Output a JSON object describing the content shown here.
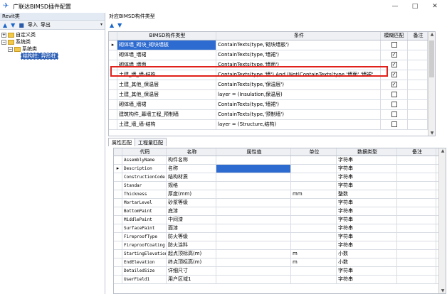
{
  "window": {
    "title": "广联达BIMSD插件配置",
    "controls": [
      "—",
      "□",
      "✕"
    ]
  },
  "left_panel": {
    "header": "Revit类",
    "toolbar": {
      "import_label": "导入",
      "export_label": "导出"
    },
    "tree": {
      "root1": "自定义类",
      "root2": "系统类",
      "child1": "系统类",
      "selected": "结构柱: 异形柱"
    }
  },
  "type_panel": {
    "header": "对应BIMSD构件类型",
    "columns": [
      "BIMSD构件类型",
      "条件",
      "模糊匹配",
      "备注"
    ],
    "rows": [
      {
        "type": "砌体墙_砌块_砌块墙板",
        "condition": "ContainTexts(type,'砌块墙板')",
        "fuzzy": false,
        "note": ""
      },
      {
        "type": "砌体墙_墙裙",
        "condition": "ContainTexts(type,'墙裙')",
        "fuzzy": true,
        "note": ""
      },
      {
        "type": "砌体墙_墙面",
        "condition": "ContainTexts(type,'墙面')",
        "fuzzy": true,
        "note": ""
      },
      {
        "type": "土建_墙_墙-结构",
        "condition": "ContainTexts(type,'墙') And (Not(ContainTexts(type,'墙面','墙裙'",
        "fuzzy": true,
        "note": ""
      },
      {
        "type": "土建_其他_保温层",
        "condition": "ContainTexts(type,'保温层')",
        "fuzzy": true,
        "note": ""
      },
      {
        "type": "土建_其他_保温层",
        "condition": "layer = (Insulation,保温层)",
        "fuzzy": false,
        "note": ""
      },
      {
        "type": "砌体墙_墙裙",
        "condition": "ContainTexts(type,'墙裙')",
        "fuzzy": false,
        "note": ""
      },
      {
        "type": "建筑构件_幕墙工程_预制墙",
        "condition": "ContainTexts(type,'预制墙')",
        "fuzzy": false,
        "note": ""
      },
      {
        "type": "土建_墙_墙-结构",
        "condition": "layer = (Structure,结构)",
        "fuzzy": false,
        "note": ""
      }
    ]
  },
  "tabs": [
    "属性匹配",
    "工程量匹配"
  ],
  "property_grid": {
    "columns": [
      "代码",
      "名称",
      "属性值",
      "单位",
      "数据类型",
      "备注"
    ],
    "rows": [
      {
        "code": "AssemblyName",
        "name": "构件名称",
        "value": "",
        "unit": "",
        "dtype": "字符串",
        "note": ""
      },
      {
        "code": "Description",
        "name": "名称",
        "value": "",
        "unit": "",
        "dtype": "字符串",
        "note": ""
      },
      {
        "code": "ConstructionCode",
        "name": "结构材质",
        "value": "",
        "unit": "",
        "dtype": "字符串",
        "note": ""
      },
      {
        "code": "Standar",
        "name": "规格",
        "value": "",
        "unit": "",
        "dtype": "字符串",
        "note": ""
      },
      {
        "code": "Thickness",
        "name": "厚度(mm)",
        "value": "",
        "unit": "mm",
        "dtype": "整数",
        "note": ""
      },
      {
        "code": "MortarLevel",
        "name": "砂浆等级",
        "value": "",
        "unit": "",
        "dtype": "字符串",
        "note": ""
      },
      {
        "code": "BottomPaint",
        "name": "底漆",
        "value": "",
        "unit": "",
        "dtype": "字符串",
        "note": ""
      },
      {
        "code": "MiddlePaint",
        "name": "中间漆",
        "value": "",
        "unit": "",
        "dtype": "字符串",
        "note": ""
      },
      {
        "code": "SurfacePaint",
        "name": "面漆",
        "value": "",
        "unit": "",
        "dtype": "字符串",
        "note": ""
      },
      {
        "code": "FireproofType",
        "name": "防火等级",
        "value": "",
        "unit": "",
        "dtype": "字符串",
        "note": ""
      },
      {
        "code": "FireproofCoating",
        "name": "防火涂料",
        "value": "",
        "unit": "",
        "dtype": "字符串",
        "note": ""
      },
      {
        "code": "StartingElevation",
        "name": "起点顶标高(m)",
        "value": "",
        "unit": "m",
        "dtype": "小数",
        "note": ""
      },
      {
        "code": "EndElevation",
        "name": "终点顶标高(m)",
        "value": "",
        "unit": "m",
        "dtype": "小数",
        "note": ""
      },
      {
        "code": "DetailedSize",
        "name": "详细尺寸",
        "value": "",
        "unit": "",
        "dtype": "字符串",
        "note": ""
      },
      {
        "code": "UserField1",
        "name": "用户区域1",
        "value": "",
        "unit": "",
        "dtype": "字符串",
        "note": ""
      }
    ]
  },
  "colors": {
    "selection": "#2d6bd0",
    "highlight_box": "#e0201a",
    "folder": "#f1c84b"
  },
  "icons": [
    "app-icon",
    "arrow-up-icon",
    "arrow-down-icon",
    "save-icon",
    "folder-icon",
    "checkbox-icon"
  ]
}
